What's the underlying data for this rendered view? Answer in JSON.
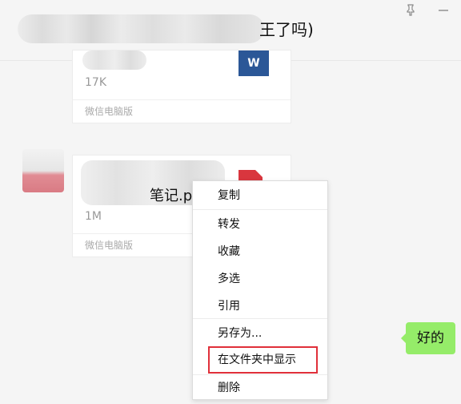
{
  "header": {
    "title_visible": "王了吗)"
  },
  "window": {
    "pin_icon": "pin-icon",
    "minimize_icon": "minimize-icon"
  },
  "messages": [
    {
      "size": "17K",
      "source": "微信电脑版",
      "icon": "word-file-icon",
      "icon_label": "W"
    },
    {
      "name_visible": "笔记.p",
      "size": "1M",
      "source": "微信电脑版",
      "icon": "pdf-file-icon"
    }
  ],
  "context_menu": {
    "items": [
      "复制",
      "转发",
      "收藏",
      "多选",
      "引用",
      "另存为...",
      "在文件夹中显示",
      "删除"
    ],
    "highlighted": "在文件夹中显示"
  },
  "reply": {
    "text": "好的",
    "color": "#95ec69"
  },
  "colors": {
    "highlight_border": "#e0303a",
    "word_blue": "#2b5797",
    "pdf_red": "#d9363e"
  }
}
